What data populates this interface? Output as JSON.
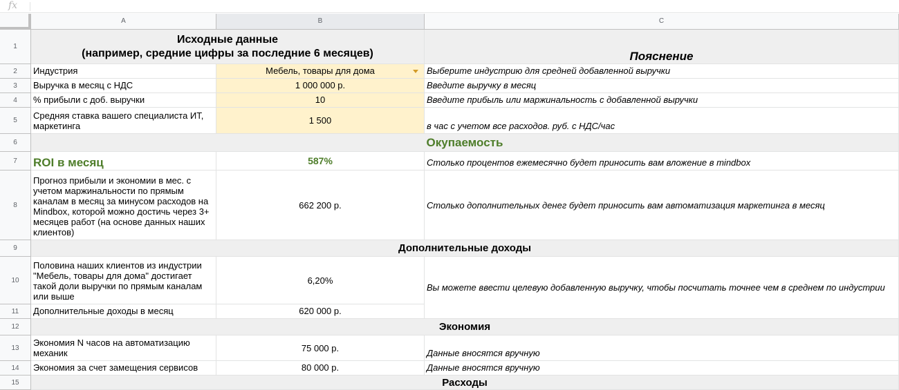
{
  "formula_bar": {
    "fx_label": "fx"
  },
  "columns": [
    "A",
    "B",
    "C"
  ],
  "rows": [
    "1",
    "2",
    "3",
    "4",
    "5",
    "6",
    "7",
    "8",
    "9",
    "10",
    "11",
    "12",
    "13",
    "14",
    "15"
  ],
  "header": {
    "title_line1": "Исходные данные",
    "title_line2": "(например, средние цифры за последние 6 месяцев)",
    "explanation": "Пояснение"
  },
  "inputs": {
    "industry": {
      "label": "Индустрия",
      "value": "Мебель, товары для дома",
      "hint": "Выберите индустрию для средней добавленной выручки"
    },
    "revenue": {
      "label": "Выручка в месяц с НДС",
      "value": "1 000 000 р.",
      "hint": "Введите выручку в месяц"
    },
    "profit_pct": {
      "label": "% прибыли с доб. выручки",
      "value": "10",
      "hint": "Введите прибыль или маржинальность с добавленной выручки"
    },
    "rate": {
      "label": "Средняя ставка вашего специалиста ИТ, маркетинга",
      "value": "1 500",
      "hint": "в час с учетом все расходов. руб. с НДС/час"
    }
  },
  "sections": {
    "payback": "Окупаемость",
    "extra_income": "Дополнительные доходы",
    "savings": "Экономия",
    "expenses": "Расходы"
  },
  "roi": {
    "label": "ROI в месяц",
    "value": "587%",
    "hint": "Столько процентов ежемесячно будет приносить вам вложение в mindbox"
  },
  "forecast": {
    "label": "Прогноз прибыли и экономии в мес. с учетом маржинальности по прямым каналам в месяц за минусом расходов на Mindbox, которой можно достичь через 3+ месяцев работ (на основе данных наших клиентов)",
    "value": "662 200 р.",
    "hint": "Столько дополнительных денег будет приносить вам автоматизация маркетинга в месяц"
  },
  "half_clients": {
    "label": "Половина наших клиентов из индустрии \"Мебель, товары для дома\" достигает такой доли выручки по прямым каналам или выше",
    "value": "6,20%",
    "hint": "Вы можете ввести целевую добавленную выручку, чтобы посчитать точнее чем в среднем по индустрии"
  },
  "extra_income_month": {
    "label": "Дополнительные доходы в месяц",
    "value": "620 000 р."
  },
  "savings_hours": {
    "label": "Экономия N часов на автоматизацию механик",
    "value": "75 000 р.",
    "hint": "Данные вносятся вручную"
  },
  "savings_services": {
    "label": "Экономия за счет замещения сервисов",
    "value": "80 000 р.",
    "hint": "Данные вносятся вручную"
  }
}
